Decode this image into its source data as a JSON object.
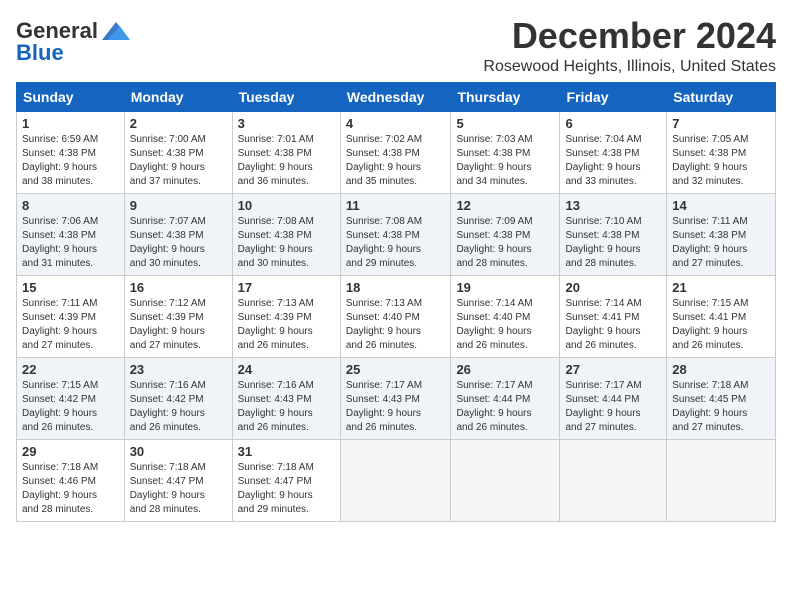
{
  "logo": {
    "general": "General",
    "blue": "Blue"
  },
  "title": {
    "month": "December 2024",
    "location": "Rosewood Heights, Illinois, United States"
  },
  "weekdays": [
    "Sunday",
    "Monday",
    "Tuesday",
    "Wednesday",
    "Thursday",
    "Friday",
    "Saturday"
  ],
  "weeks": [
    [
      {
        "day": "1",
        "info": "Sunrise: 6:59 AM\nSunset: 4:38 PM\nDaylight: 9 hours\nand 38 minutes."
      },
      {
        "day": "2",
        "info": "Sunrise: 7:00 AM\nSunset: 4:38 PM\nDaylight: 9 hours\nand 37 minutes."
      },
      {
        "day": "3",
        "info": "Sunrise: 7:01 AM\nSunset: 4:38 PM\nDaylight: 9 hours\nand 36 minutes."
      },
      {
        "day": "4",
        "info": "Sunrise: 7:02 AM\nSunset: 4:38 PM\nDaylight: 9 hours\nand 35 minutes."
      },
      {
        "day": "5",
        "info": "Sunrise: 7:03 AM\nSunset: 4:38 PM\nDaylight: 9 hours\nand 34 minutes."
      },
      {
        "day": "6",
        "info": "Sunrise: 7:04 AM\nSunset: 4:38 PM\nDaylight: 9 hours\nand 33 minutes."
      },
      {
        "day": "7",
        "info": "Sunrise: 7:05 AM\nSunset: 4:38 PM\nDaylight: 9 hours\nand 32 minutes."
      }
    ],
    [
      {
        "day": "8",
        "info": "Sunrise: 7:06 AM\nSunset: 4:38 PM\nDaylight: 9 hours\nand 31 minutes."
      },
      {
        "day": "9",
        "info": "Sunrise: 7:07 AM\nSunset: 4:38 PM\nDaylight: 9 hours\nand 30 minutes."
      },
      {
        "day": "10",
        "info": "Sunrise: 7:08 AM\nSunset: 4:38 PM\nDaylight: 9 hours\nand 30 minutes."
      },
      {
        "day": "11",
        "info": "Sunrise: 7:08 AM\nSunset: 4:38 PM\nDaylight: 9 hours\nand 29 minutes."
      },
      {
        "day": "12",
        "info": "Sunrise: 7:09 AM\nSunset: 4:38 PM\nDaylight: 9 hours\nand 28 minutes."
      },
      {
        "day": "13",
        "info": "Sunrise: 7:10 AM\nSunset: 4:38 PM\nDaylight: 9 hours\nand 28 minutes."
      },
      {
        "day": "14",
        "info": "Sunrise: 7:11 AM\nSunset: 4:38 PM\nDaylight: 9 hours\nand 27 minutes."
      }
    ],
    [
      {
        "day": "15",
        "info": "Sunrise: 7:11 AM\nSunset: 4:39 PM\nDaylight: 9 hours\nand 27 minutes."
      },
      {
        "day": "16",
        "info": "Sunrise: 7:12 AM\nSunset: 4:39 PM\nDaylight: 9 hours\nand 27 minutes."
      },
      {
        "day": "17",
        "info": "Sunrise: 7:13 AM\nSunset: 4:39 PM\nDaylight: 9 hours\nand 26 minutes."
      },
      {
        "day": "18",
        "info": "Sunrise: 7:13 AM\nSunset: 4:40 PM\nDaylight: 9 hours\nand 26 minutes."
      },
      {
        "day": "19",
        "info": "Sunrise: 7:14 AM\nSunset: 4:40 PM\nDaylight: 9 hours\nand 26 minutes."
      },
      {
        "day": "20",
        "info": "Sunrise: 7:14 AM\nSunset: 4:41 PM\nDaylight: 9 hours\nand 26 minutes."
      },
      {
        "day": "21",
        "info": "Sunrise: 7:15 AM\nSunset: 4:41 PM\nDaylight: 9 hours\nand 26 minutes."
      }
    ],
    [
      {
        "day": "22",
        "info": "Sunrise: 7:15 AM\nSunset: 4:42 PM\nDaylight: 9 hours\nand 26 minutes."
      },
      {
        "day": "23",
        "info": "Sunrise: 7:16 AM\nSunset: 4:42 PM\nDaylight: 9 hours\nand 26 minutes."
      },
      {
        "day": "24",
        "info": "Sunrise: 7:16 AM\nSunset: 4:43 PM\nDaylight: 9 hours\nand 26 minutes."
      },
      {
        "day": "25",
        "info": "Sunrise: 7:17 AM\nSunset: 4:43 PM\nDaylight: 9 hours\nand 26 minutes."
      },
      {
        "day": "26",
        "info": "Sunrise: 7:17 AM\nSunset: 4:44 PM\nDaylight: 9 hours\nand 26 minutes."
      },
      {
        "day": "27",
        "info": "Sunrise: 7:17 AM\nSunset: 4:44 PM\nDaylight: 9 hours\nand 27 minutes."
      },
      {
        "day": "28",
        "info": "Sunrise: 7:18 AM\nSunset: 4:45 PM\nDaylight: 9 hours\nand 27 minutes."
      }
    ],
    [
      {
        "day": "29",
        "info": "Sunrise: 7:18 AM\nSunset: 4:46 PM\nDaylight: 9 hours\nand 28 minutes."
      },
      {
        "day": "30",
        "info": "Sunrise: 7:18 AM\nSunset: 4:47 PM\nDaylight: 9 hours\nand 28 minutes."
      },
      {
        "day": "31",
        "info": "Sunrise: 7:18 AM\nSunset: 4:47 PM\nDaylight: 9 hours\nand 29 minutes."
      },
      null,
      null,
      null,
      null
    ]
  ]
}
